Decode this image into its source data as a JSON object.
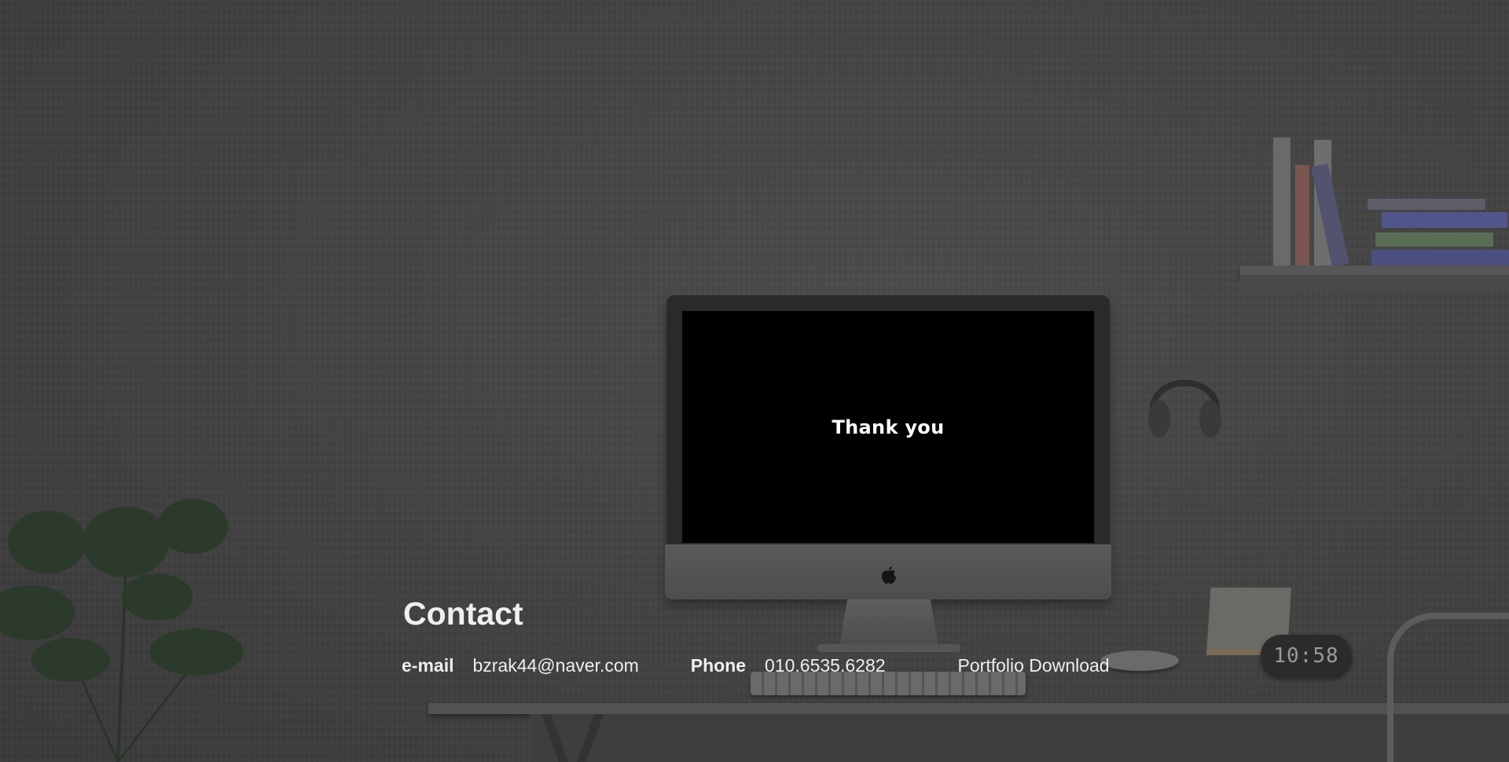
{
  "screen": {
    "message": "Thank you"
  },
  "clock": {
    "time": "10:58"
  },
  "contact": {
    "title": "Contact",
    "email_label": "e-mail",
    "email_value": "bzrak44@naver.com",
    "phone_label": "Phone",
    "phone_value": "010.6535.6282",
    "download_label": "Portfolio Download"
  },
  "icons": {
    "monitor_logo": "apple-icon"
  }
}
